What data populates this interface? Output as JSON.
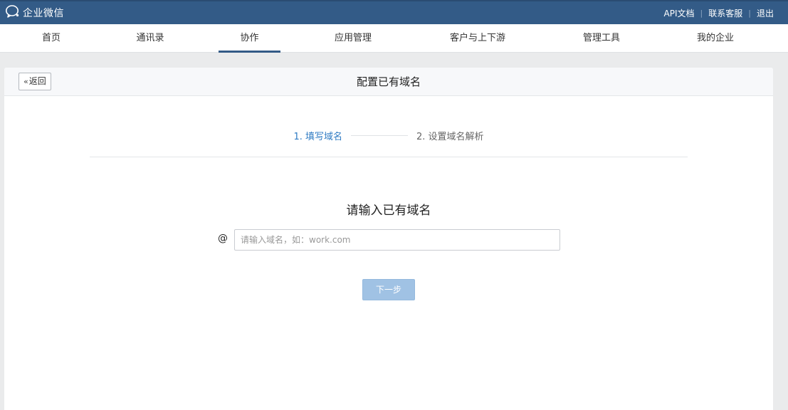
{
  "app": {
    "title": "企业微信",
    "logo_icon": "wechat-work-logo-icon"
  },
  "top_links": [
    {
      "label": "API文档"
    },
    {
      "label": "联系客服"
    },
    {
      "label": "退出"
    }
  ],
  "nav": {
    "items": [
      {
        "label": "首页"
      },
      {
        "label": "通讯录"
      },
      {
        "label": "协作",
        "active": true
      },
      {
        "label": "应用管理"
      },
      {
        "label": "客户与上下游"
      },
      {
        "label": "管理工具"
      },
      {
        "label": "我的企业"
      }
    ]
  },
  "page": {
    "back_label": "返回",
    "title": "配置已有域名"
  },
  "steps": {
    "step1": "1. 填写域名",
    "step2": "2. 设置域名解析"
  },
  "form": {
    "title": "请输入已有域名",
    "at_symbol": "@",
    "domain_value": "",
    "domain_placeholder": "请输入域名，如：work.com",
    "next_label": "下一步"
  },
  "colors": {
    "topbar": "#335b87",
    "active_step": "#2f7bc3",
    "next_button_disabled": "#a0c2e4"
  }
}
